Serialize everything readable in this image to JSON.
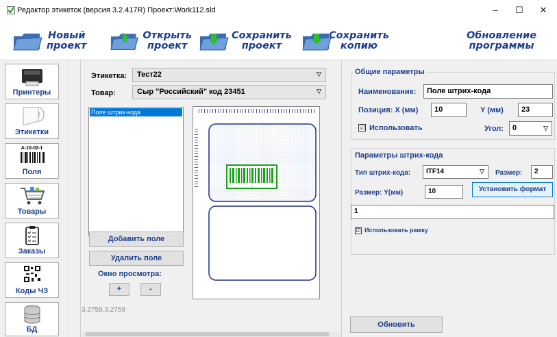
{
  "window": {
    "title": "Редактор этикеток (версия 3.2.417R) Проект:Work112.sld",
    "controls": {
      "minimize": "–",
      "maximize": "☐",
      "close": "✕"
    }
  },
  "toolbar": {
    "new_project": [
      "Новый",
      "проект"
    ],
    "open_project": [
      "Открыть",
      "проект"
    ],
    "save_project": [
      "Сохранить",
      "проект"
    ],
    "save_copy": [
      "Сохранить",
      "копию"
    ],
    "update": [
      "Обновление",
      "программы"
    ]
  },
  "sidebar": {
    "items": [
      {
        "label": "Принтеры",
        "icon": "printer-icon"
      },
      {
        "label": "Этикетки",
        "icon": "label-roll-icon"
      },
      {
        "label": "Поля",
        "icon": "barcode-icon",
        "caption": "A-10-02-1"
      },
      {
        "label": "Товары",
        "icon": "cart-icon"
      },
      {
        "label": "Заказы",
        "icon": "clipboard-icon"
      },
      {
        "label": "Коды ЧЗ",
        "icon": "qr-code-icon"
      },
      {
        "label": "БД",
        "icon": "database-icon"
      }
    ]
  },
  "center": {
    "label_caption": "Этикетка:",
    "label_value": "Тест22",
    "product_caption": "Товар:",
    "product_value": "Сыр \"Российский\" код 23451",
    "fields_list": [
      "Поле штрих-кода"
    ],
    "add_field": "Добавить поле",
    "remove_field": "Удалить поле",
    "preview_window": "Окно просмотра:",
    "zoom_in": "+",
    "zoom_out": "-",
    "coords": "3,2759,3,2759",
    "barcode_caption": "1"
  },
  "general": {
    "title": "Общие параметры",
    "name_caption": "Наименование:",
    "name_value": "Поле штрих-кода",
    "position_caption": "Позиция:  X (мм)",
    "x_value": "10",
    "y_caption": "Y (мм)",
    "y_value": "23",
    "use_caption": "Использовать",
    "use_checked": "☑",
    "angle_caption": "Угол:",
    "angle_value": "0"
  },
  "barcode_params": {
    "title": "Параметры штрих-кода",
    "type_caption": "Тип штрих-кода:",
    "type_value": "ITF14",
    "size_caption": "Размер:",
    "size_value": "2",
    "size_y_caption": "Размер: Y(мм)",
    "size_y_value": "10",
    "set_format": "Установить формат",
    "data_value": "1",
    "use_frame_caption": "Использовать рамку",
    "use_frame_checked": "☑"
  },
  "footer": {
    "refresh": "Обновить"
  },
  "colors": {
    "accent": "#1c3f8c",
    "selection": "#0078d7",
    "barcode": "#1aa11a",
    "frame": "#1c2f8c"
  }
}
